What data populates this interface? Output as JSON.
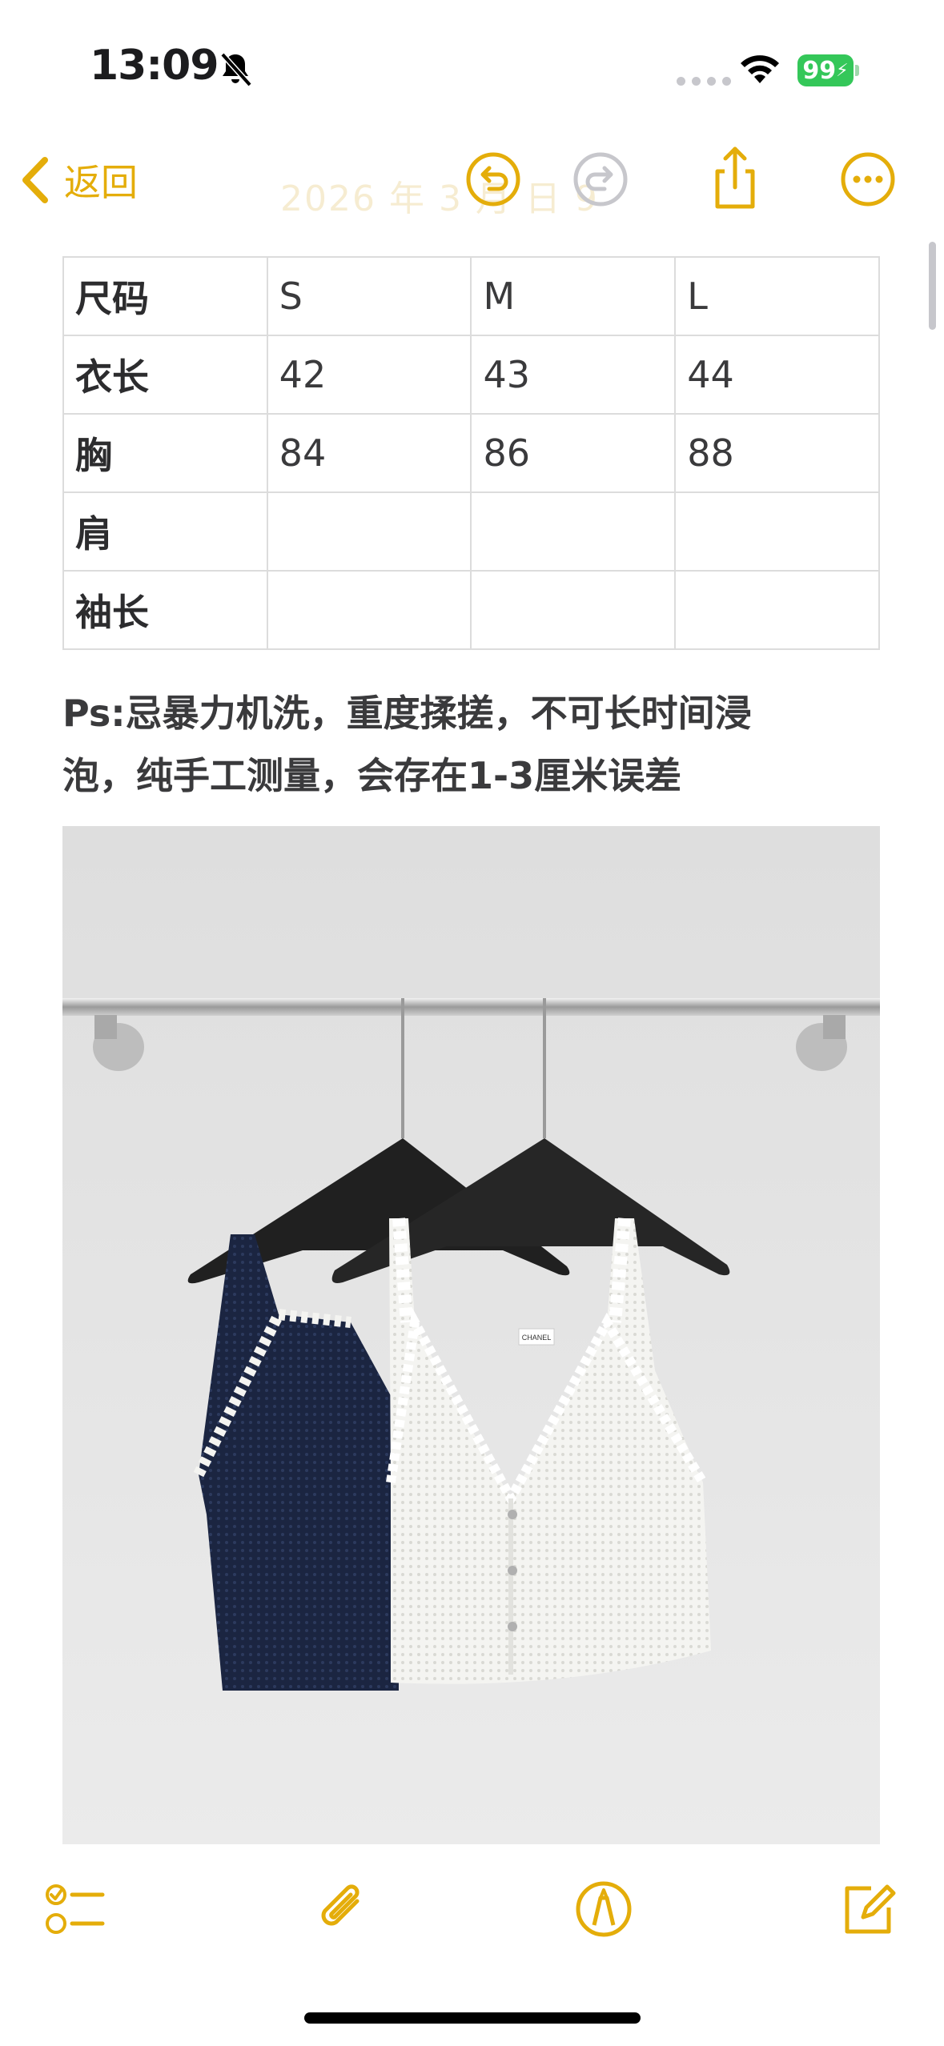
{
  "status_bar": {
    "time": "13:09",
    "battery": "99"
  },
  "nav": {
    "back_label": "返回",
    "faded_title": "2026 年 3 月 日 9"
  },
  "size_table": {
    "header": [
      "尺码",
      "S",
      "M",
      "L"
    ],
    "rows": [
      [
        "衣长",
        "42",
        "43",
        "44"
      ],
      [
        "胸",
        "84",
        "86",
        "88"
      ],
      [
        "肩",
        "",
        "",
        ""
      ],
      [
        "袖长",
        "",
        "",
        ""
      ]
    ]
  },
  "note": {
    "line1": "Ps:忌暴力机洗，重度揉搓，不可长时间浸",
    "line2": "泡，纯手工测量，会存在1-3厘米误差"
  },
  "photo": {
    "label_text": "CHANEL"
  },
  "colors": {
    "accent": "#e4ad0a",
    "battery_green": "#34c759"
  },
  "icons": {
    "nav": [
      "chevron-left-icon",
      "undo-icon",
      "redo-icon",
      "share-icon",
      "more-icon"
    ],
    "toolbar": [
      "checklist-icon",
      "paperclip-icon",
      "markup-pen-icon",
      "compose-icon"
    ]
  }
}
